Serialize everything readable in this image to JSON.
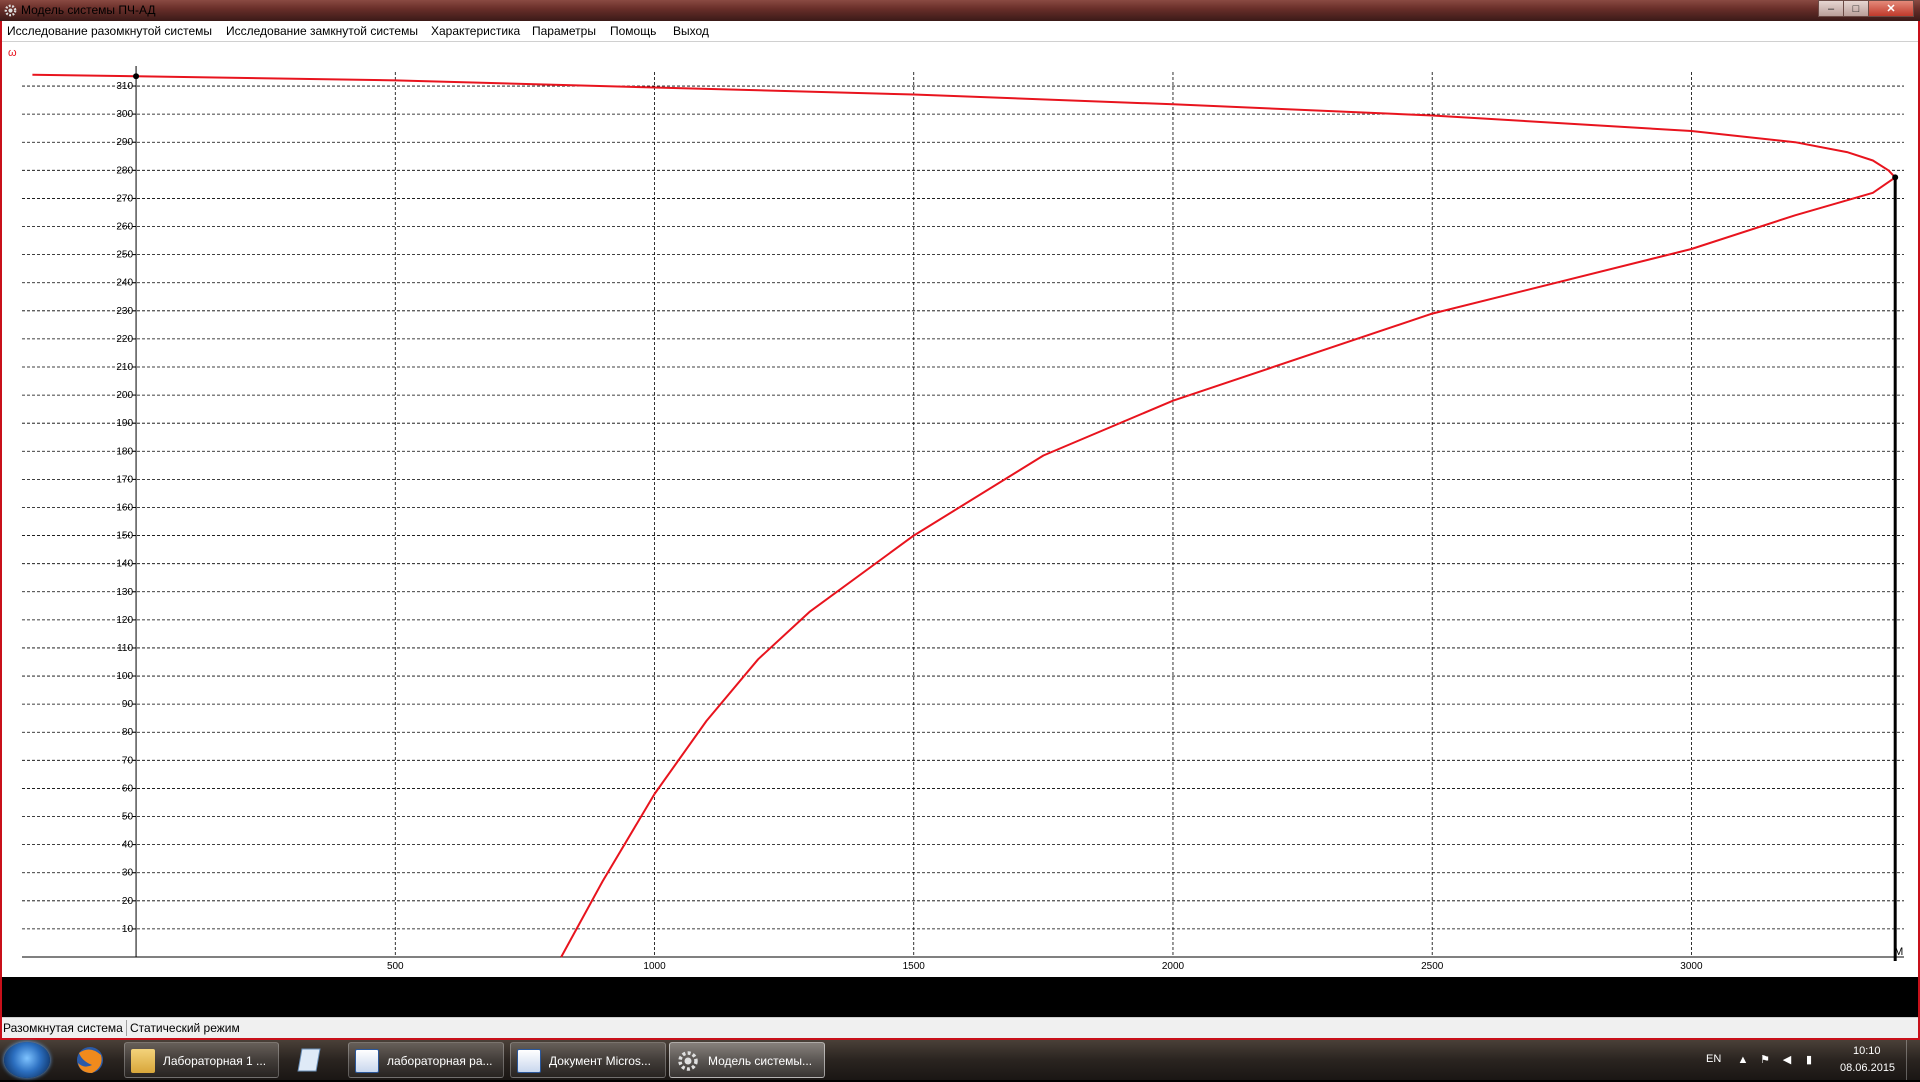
{
  "window": {
    "title": "Модель системы ПЧ-АД",
    "controls": {
      "minimize": "–",
      "maximize": "□",
      "close": "✕"
    }
  },
  "menu": {
    "items": [
      {
        "label": "Исследование разомкнутой системы"
      },
      {
        "label": "Исследование замкнутой системы"
      },
      {
        "label": "Характеристика"
      },
      {
        "label": "Параметры"
      },
      {
        "label": "Помощь"
      },
      {
        "label": "Выход"
      }
    ]
  },
  "status": {
    "mode": "Разомкнутая система",
    "regime": "Статический режим"
  },
  "taskbar": {
    "start_icon": "windows-orb-icon",
    "pinned": [
      {
        "icon": "firefox-icon"
      },
      {
        "icon": "folder-icon"
      },
      {
        "icon": "notepad-icon"
      }
    ],
    "tasks": [
      {
        "label": "Лабораторная 1 ...",
        "icon": "folder-icon",
        "active": false
      },
      {
        "label": "лабораторная ра...",
        "icon": "word-document-icon",
        "active": false
      },
      {
        "label": "Документ Micros...",
        "icon": "word-document-icon",
        "active": false
      },
      {
        "label": "Модель системы...",
        "icon": "gear-icon",
        "active": true
      }
    ],
    "language": "EN",
    "time": "10:10",
    "date": "08.06.2015"
  },
  "chart_data": {
    "type": "line",
    "ylabel": "ω",
    "xlabel": "M",
    "xlim": [
      -220,
      3410
    ],
    "ylim": [
      0,
      315
    ],
    "x_ticks": [
      500,
      1000,
      1500,
      2000,
      2500,
      3000
    ],
    "y_ticks": [
      10,
      20,
      30,
      40,
      50,
      60,
      70,
      80,
      90,
      100,
      110,
      120,
      130,
      140,
      150,
      160,
      170,
      180,
      190,
      200,
      210,
      220,
      230,
      240,
      250,
      260,
      270,
      280,
      290,
      300,
      310
    ],
    "grid": true,
    "colors": {
      "curve": "#e8141e",
      "axis": "#000000",
      "grid": "#000000"
    },
    "series": [
      {
        "points": [
          [
            -200,
            314
          ],
          [
            0,
            313.5
          ],
          [
            500,
            312
          ],
          [
            1000,
            309.5
          ],
          [
            1500,
            307
          ],
          [
            2000,
            303.5
          ],
          [
            2500,
            299.5
          ],
          [
            3000,
            294
          ],
          [
            3200,
            290
          ],
          [
            3300,
            286.5
          ],
          [
            3350,
            283.5
          ],
          [
            3380,
            280
          ],
          [
            3393,
            277.5
          ],
          [
            3350,
            272
          ],
          [
            3200,
            264
          ],
          [
            3000,
            252
          ],
          [
            2500,
            229
          ],
          [
            2000,
            198
          ],
          [
            1750,
            178.5
          ],
          [
            1500,
            150
          ],
          [
            1300,
            123
          ],
          [
            1200,
            106
          ],
          [
            1100,
            84
          ],
          [
            1000,
            58
          ],
          [
            900,
            27
          ],
          [
            820,
            0
          ]
        ]
      }
    ],
    "markers": [
      [
        0,
        313.5
      ],
      [
        3393,
        277.5
      ]
    ]
  }
}
